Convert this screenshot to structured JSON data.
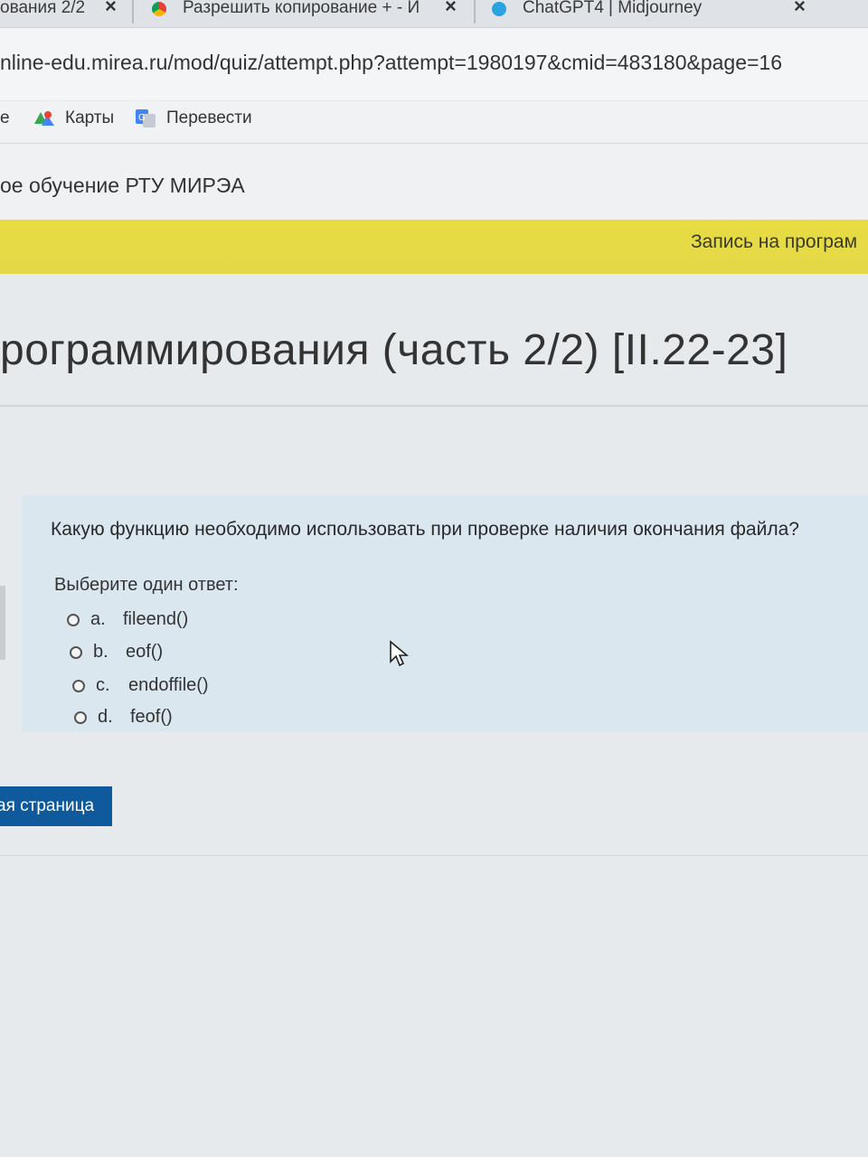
{
  "tabs": [
    {
      "title": "ования 2/2"
    },
    {
      "title": "Разрешить копирование + - И"
    },
    {
      "title": "ChatGPT4 | Midjourney"
    }
  ],
  "address_bar": {
    "url": "nline-edu.mirea.ru/mod/quiz/attempt.php?attempt=1980197&cmid=483180&page=16"
  },
  "bookmarks": [
    {
      "label": "е"
    },
    {
      "label": "Карты"
    },
    {
      "label": "Перевести"
    }
  ],
  "site": {
    "name": "ое обучение РТУ МИРЭА",
    "banner": "Запись на програм"
  },
  "course": {
    "title": "рограммирования (часть 2/2) [II.22-23]"
  },
  "question": {
    "text": "Какую функцию необходимо использовать при проверке наличия окончания файла?",
    "prompt": "Выберите один ответ:",
    "options": [
      {
        "letter": "a.",
        "text": "fileend()"
      },
      {
        "letter": "b.",
        "text": "eof()"
      },
      {
        "letter": "c.",
        "text": "endoffile()"
      },
      {
        "letter": "d.",
        "text": "feof()"
      }
    ]
  },
  "navigation": {
    "next_label": "ая страница"
  },
  "colors": {
    "banner": "#e6da45",
    "button": "#0e5a9c",
    "question_bg": "#dbe7ee"
  }
}
